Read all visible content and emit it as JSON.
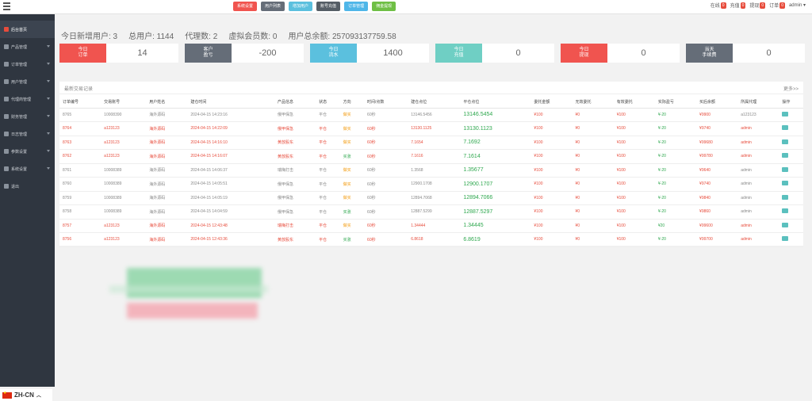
{
  "topbar": {
    "buttons": [
      {
        "label": "系统设置",
        "color": "#f0544f"
      },
      {
        "label": "用户列表",
        "color": "#656d78"
      },
      {
        "label": "增加用户",
        "color": "#5bc0de"
      },
      {
        "label": "账号充值",
        "color": "#555e66"
      },
      {
        "label": "订单管理",
        "color": "#4fb6e8"
      },
      {
        "label": "佣金提现",
        "color": "#6fbf45"
      }
    ],
    "stats": [
      {
        "label": "在线",
        "count": "0"
      },
      {
        "label": "充值",
        "count": "0"
      },
      {
        "label": "提现",
        "count": "0"
      },
      {
        "label": "订单",
        "count": "0"
      }
    ],
    "user": "admin"
  },
  "sidebar": {
    "items": [
      {
        "label": "后台首页",
        "icon": "cloud-icon",
        "active": true
      },
      {
        "label": "产品管理",
        "icon": "bitcoin-icon"
      },
      {
        "label": "订单管理",
        "icon": "document-icon"
      },
      {
        "label": "用户管理",
        "icon": "user-icon"
      },
      {
        "label": "代理商管理",
        "icon": "users-icon"
      },
      {
        "label": "财务管理",
        "icon": "money-icon"
      },
      {
        "label": "日志管理",
        "icon": "log-icon"
      },
      {
        "label": "参数设置",
        "icon": "dollar-icon"
      },
      {
        "label": "系统设置",
        "icon": "gear-icon"
      },
      {
        "label": "退出",
        "icon": "logout-icon"
      }
    ],
    "language": "ZH-CN"
  },
  "summary": {
    "new_users": "今日新增用户: 3",
    "total_users": "总用户: 1144",
    "agents": "代理数: 2",
    "virtual_members": "虚拟会员数: 0",
    "total_balance": "用户总余额: 257093137759.58"
  },
  "cards": [
    {
      "label1": "今日",
      "label2": "订单",
      "value": "14",
      "color": "#f0544f"
    },
    {
      "label1": "客户",
      "label2": "盈亏",
      "value": "-200",
      "color": "#656d78"
    },
    {
      "label1": "今日",
      "label2": "流水",
      "value": "1400",
      "color": "#5bc0de"
    },
    {
      "label1": "今日",
      "label2": "充值",
      "value": "0",
      "color": "#6fcfc4"
    },
    {
      "label1": "今日",
      "label2": "提现",
      "value": "0",
      "color": "#f0544f"
    },
    {
      "label1": "当天",
      "label2": "手续费",
      "value": "0",
      "color": "#656d78"
    }
  ],
  "table": {
    "title": "最新交易记录",
    "more": "更多>>",
    "headers": [
      "订单编号",
      "交易账号",
      "用户姓名",
      "建仓时间",
      "产品信息",
      "状态",
      "方向",
      "时间/点数",
      "建仓点位",
      "平仓点位",
      "委托金额",
      "无效委托",
      "有效委托",
      "实际盈亏",
      "买后余额",
      "所属代理",
      "操作"
    ],
    "rows": [
      {
        "red": false,
        "cells": [
          "8765",
          "10008390",
          "海外源码",
          "2024-04-15 14:23:16",
          "俄甲保急",
          "平仓",
          "做买",
          "60秒",
          "13146.5456",
          "13146.5454",
          "¥100",
          "¥0",
          "¥100",
          "¥-20",
          "¥9900",
          "a123123"
        ]
      },
      {
        "red": true,
        "cells": [
          "8764",
          "a123123",
          "海外源码",
          "2024-04-15 14:22:09",
          "俄甲保急",
          "平仓",
          "做买",
          "60秒",
          "13130.1125",
          "13130.1123",
          "¥100",
          "¥0",
          "¥100",
          "¥-20",
          "¥9740",
          "admin"
        ]
      },
      {
        "red": true,
        "cells": [
          "8763",
          "a123123",
          "海外源码",
          "2024-04-15 14:16:10",
          "黄放股东",
          "平仓",
          "做买",
          "60秒",
          "7.1654",
          "7.1692",
          "¥100",
          "¥0",
          "¥100",
          "¥-20",
          "¥99680",
          "admin"
        ]
      },
      {
        "red": true,
        "cells": [
          "8762",
          "a123123",
          "海外源码",
          "2024-04-15 14:16:07",
          "黄放股东",
          "平仓",
          "买涨",
          "60秒",
          "7.1616",
          "7.1614",
          "¥100",
          "¥0",
          "¥100",
          "¥-20",
          "¥99780",
          "admin"
        ]
      },
      {
        "red": false,
        "cells": [
          "8761",
          "10008389",
          "海外源码",
          "2024-04-15 14:06:37",
          "瑞梅打击",
          "平仓",
          "做买",
          "60秒",
          "1.3568",
          "1.35677",
          "¥100",
          "¥0",
          "¥100",
          "¥-20",
          "¥9640",
          "admin"
        ]
      },
      {
        "red": false,
        "cells": [
          "8760",
          "10008389",
          "海外源码",
          "2024-04-15 14:05:51",
          "俄甲保急",
          "平仓",
          "做买",
          "60秒",
          "12900.1708",
          "12900.1707",
          "¥100",
          "¥0",
          "¥100",
          "¥-20",
          "¥9740",
          "admin"
        ]
      },
      {
        "red": false,
        "cells": [
          "8759",
          "10008389",
          "海外源码",
          "2024-04-15 14:05:19",
          "俄甲保急",
          "平仓",
          "做买",
          "60秒",
          "12894.7068",
          "12894.7066",
          "¥100",
          "¥0",
          "¥100",
          "¥-20",
          "¥9840",
          "admin"
        ]
      },
      {
        "red": false,
        "cells": [
          "8758",
          "10008389",
          "海外源码",
          "2024-04-15 14:04:59",
          "俄甲保急",
          "平仓",
          "买涨",
          "60秒",
          "12887.5299",
          "12887.5297",
          "¥100",
          "¥0",
          "¥100",
          "¥-20",
          "¥9860",
          "admin"
        ]
      },
      {
        "red": true,
        "cells": [
          "8757",
          "a123123",
          "海外源码",
          "2024-04-15 12:43:48",
          "瑞梅打击",
          "平仓",
          "做买",
          "60秒",
          "1.34444",
          "1.34445",
          "¥100",
          "¥0",
          "¥100",
          "¥20",
          "¥99600",
          "admin"
        ]
      },
      {
        "red": true,
        "cells": [
          "8756",
          "a123123",
          "海外源码",
          "2024-04-15 12:43:36",
          "黄放股东",
          "平仓",
          "买涨",
          "60秒",
          "6.8618",
          "6.8619",
          "¥100",
          "¥0",
          "¥100",
          "¥-20",
          "¥99700",
          "admin"
        ]
      }
    ]
  }
}
